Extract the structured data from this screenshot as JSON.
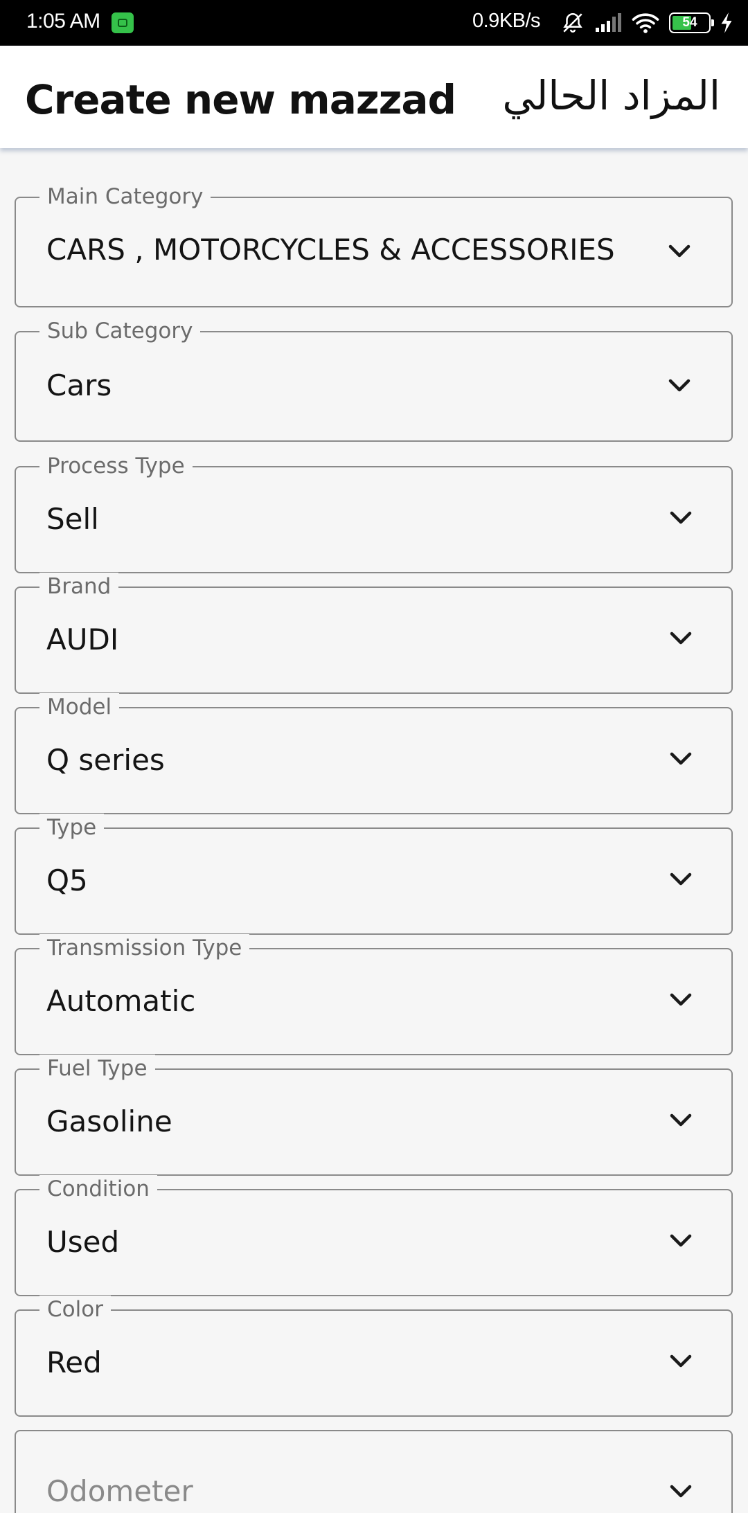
{
  "status_bar": {
    "time": "1:05 AM",
    "speed": "0.9KB/s",
    "battery": "54",
    "battery_level": 0.54,
    "icons": [
      "notification-app-icon",
      "bell-off-icon",
      "signal-icon",
      "wifi-icon",
      "battery-icon",
      "charging-bolt-icon"
    ]
  },
  "app_bar": {
    "title": "Create new mazzad",
    "language_toggle": "المزاد الحالي"
  },
  "form": {
    "fields": [
      {
        "label": "Main Category",
        "value": "CARS , MOTORCYCLES & ACCESSORIES"
      },
      {
        "label": "Sub Category",
        "value": "Cars"
      },
      {
        "label": "Process  Type",
        "value": "Sell"
      },
      {
        "label": "Brand",
        "value": "AUDI"
      },
      {
        "label": "Model",
        "value": "Q series"
      },
      {
        "label": "Type",
        "value": "Q5"
      },
      {
        "label": "Transmission Type",
        "value": "Automatic"
      },
      {
        "label": "Fuel Type",
        "value": "Gasoline"
      },
      {
        "label": "Condition",
        "value": "Used"
      },
      {
        "label": "Color",
        "value": "Red"
      }
    ],
    "odometer": {
      "placeholder": "Odometer"
    }
  },
  "colors": {
    "status_bar_bg": "#000000",
    "app_bar_bg": "#ffffff",
    "page_bg": "#f6f6f6",
    "field_border": "#8a8a8a",
    "label_text": "#6b6b6b",
    "value_text": "#141414",
    "battery_fill": "#36c24b"
  }
}
